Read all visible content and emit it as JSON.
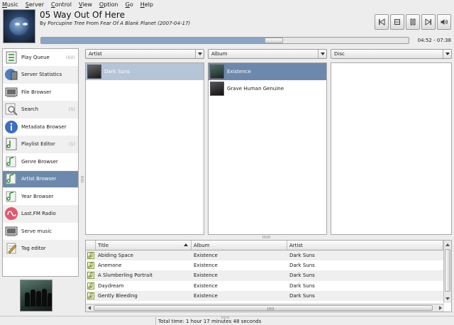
{
  "menu": [
    "Music",
    "Server",
    "Control",
    "View",
    "Option",
    "Go",
    "Help"
  ],
  "now_playing": {
    "title": "05 Way Out Of Here",
    "by_label": "By",
    "artist": "Porcupine Tree",
    "from_label": "From",
    "album_year": "Fear Of A Blank Planet (2007-04-17)",
    "time": "04:52 - 07:38",
    "progress": 0.615
  },
  "controls": [
    {
      "name": "previous-button",
      "icon": "previous-track-icon"
    },
    {
      "name": "stop-button",
      "icon": "stop-icon"
    },
    {
      "name": "pause-button",
      "icon": "pause-icon"
    },
    {
      "name": "next-button",
      "icon": "next-track-icon"
    },
    {
      "name": "volume-button",
      "icon": "volume-icon"
    }
  ],
  "sidebar": {
    "items": [
      {
        "label": "Play Queue",
        "count": "(60)",
        "icon": "play-queue-icon"
      },
      {
        "label": "Server Statistics",
        "count": "",
        "icon": "server-statistics-icon"
      },
      {
        "label": "File Browser",
        "count": "",
        "icon": "file-browser-icon"
      },
      {
        "label": "Search",
        "count": "(5)",
        "icon": "search-icon"
      },
      {
        "label": "Metadata Browser",
        "count": "",
        "icon": "info-icon"
      },
      {
        "label": "Playlist Editor",
        "count": "(1)",
        "icon": "playlist-editor-icon"
      },
      {
        "label": "Genre Browser",
        "count": "",
        "icon": "genre-browser-icon"
      },
      {
        "label": "Artist Browser",
        "count": "",
        "icon": "artist-browser-icon",
        "active": true
      },
      {
        "label": "Year Browser",
        "count": "",
        "icon": "year-browser-icon"
      },
      {
        "label": "Last.FM Radio",
        "count": "",
        "icon": "lastfm-icon"
      },
      {
        "label": "Serve music",
        "count": "",
        "icon": "serve-music-icon"
      },
      {
        "label": "Tag editor",
        "count": "",
        "icon": "tag-editor-icon"
      }
    ]
  },
  "browser": {
    "columns": [
      {
        "header": "Artist",
        "items": [
          {
            "label": "Dark Suns",
            "selected": "dim"
          }
        ]
      },
      {
        "header": "Album",
        "items": [
          {
            "label": "Existence",
            "selected": "active"
          },
          {
            "label": "Grave Human Genuine",
            "selected": ""
          }
        ]
      },
      {
        "header": "Disc",
        "items": []
      }
    ]
  },
  "tracks": {
    "headers": [
      "Title",
      "Album",
      "Artist"
    ],
    "rows": [
      [
        "Abiding Space",
        "Existence",
        "Dark Suns"
      ],
      [
        "Anemone",
        "Existence",
        "Dark Suns"
      ],
      [
        "A Slumberling Portrait",
        "Existence",
        "Dark Suns"
      ],
      [
        "Daydream",
        "Existence",
        "Dark Suns"
      ],
      [
        "Gently Bleeding",
        "Existence",
        "Dark Suns"
      ]
    ]
  },
  "status": {
    "total_time": "Total time: 1 hour 17 minutes 48 seconds"
  },
  "colors": {
    "selection": "#6c89ad",
    "selection_dim": "#b5c5d8",
    "progress_fill": "#8aa4c6"
  }
}
